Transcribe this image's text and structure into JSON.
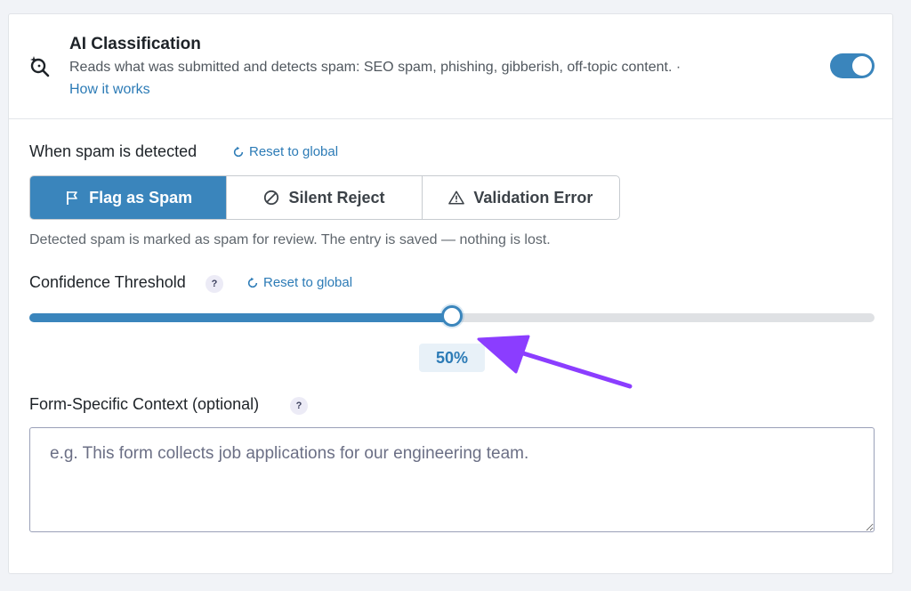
{
  "header": {
    "title": "AI Classification",
    "description": "Reads what was submitted and detects spam: SEO spam, phishing, gibberish, off-topic content. ·",
    "link_label": "How it works",
    "toggle_on": true,
    "icon": "magnify-sparkle-icon"
  },
  "action": {
    "label": "When spam is detected",
    "reset_label": "Reset to global",
    "options": [
      {
        "label": "Flag as Spam",
        "icon": "flag-icon",
        "active": true
      },
      {
        "label": "Silent Reject",
        "icon": "ban-icon",
        "active": false
      },
      {
        "label": "Validation Error",
        "icon": "warning-icon",
        "active": false
      }
    ],
    "hint": "Detected spam is marked as spam for review. The entry is saved — nothing is lost."
  },
  "threshold": {
    "label": "Confidence Threshold",
    "help": "?",
    "reset_label": "Reset to global",
    "value": 50,
    "value_label": "50%"
  },
  "context": {
    "label": "Form-Specific Context (optional)",
    "help": "?",
    "placeholder": "e.g. This form collects job applications for our engineering team.",
    "value": ""
  },
  "colors": {
    "accent": "#3a85bc",
    "link": "#2c7bb6",
    "annotation_arrow": "#8b3dff"
  }
}
